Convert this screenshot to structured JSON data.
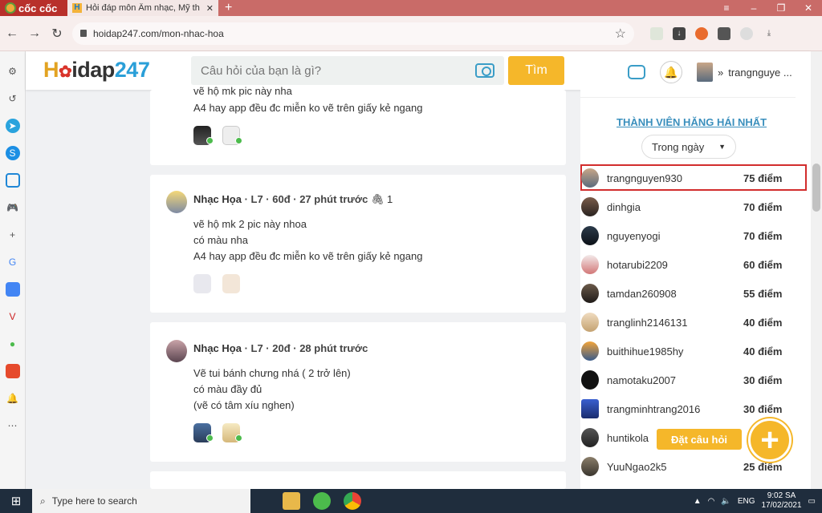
{
  "browser": {
    "brand": "cốc cốc",
    "tab_title": "Hỏi đáp môn Âm nhạc, Mỹ th",
    "url": "hoidap247.com/mon-nhac-hoa"
  },
  "site": {
    "logo_h": "H",
    "logo_mid": "idap",
    "logo_num": "247",
    "search_placeholder": "Câu hỏi của bạn là gì?",
    "search_button": "Tìm",
    "username": "trangnguye ..."
  },
  "posts": [
    {
      "lines": [
        "vẽ hộ mk pic này nha",
        "A4 hay app đều đc miễn ko vẽ trên giấy kẻ ngang"
      ]
    },
    {
      "author": "Nhạc Họa",
      "meta": " · L7 · 60đ · 27 phút trước",
      "attachments": "🖇 1",
      "lines": [
        "vẽ hộ mk 2 pic này nhoa",
        "có màu nha",
        "A4 hay app đều đc miễn ko vẽ trên giấy kẻ ngang"
      ]
    },
    {
      "author": "Nhạc Họa",
      "meta": " · L7 · 20đ · 28 phút trước",
      "lines": [
        "Vẽ tui bánh chưng nhá ( 2 trở lên)",
        "có màu đầy đủ",
        "(vẽ có tâm xíu nghen)"
      ]
    }
  ],
  "leaderboard": {
    "title": "THÀNH VIÊN HĂNG HÁI NHẤT",
    "period": "Trong ngày",
    "members": [
      {
        "name": "trangnguyen930",
        "points": "75 điểm"
      },
      {
        "name": "dinhgia",
        "points": "70 điểm"
      },
      {
        "name": "nguyenyogi",
        "points": "70 điểm"
      },
      {
        "name": "hotarubi2209",
        "points": "60 điểm"
      },
      {
        "name": "tamdan260908",
        "points": "55 điểm"
      },
      {
        "name": "tranglinh2146131",
        "points": "40 điểm"
      },
      {
        "name": "buithihue1985hy",
        "points": "40 điểm"
      },
      {
        "name": "namotaku2007",
        "points": "30 điểm"
      },
      {
        "name": "trangminhtrang2016",
        "points": "30 điểm"
      },
      {
        "name": "huntikola",
        "points": ""
      },
      {
        "name": "YuuNgao2k5",
        "points": "25 điểm"
      }
    ]
  },
  "ask": {
    "label": "Đặt câu hỏi",
    "icon": "+"
  },
  "taskbar": {
    "search_placeholder": "Type here to search",
    "lang": "ENG",
    "time": "9:02 SA",
    "date": "17/02/2021"
  },
  "colors": {
    "accent": "#f5b72a",
    "link": "#3a8fbd",
    "highlight": "#d22d2d"
  }
}
